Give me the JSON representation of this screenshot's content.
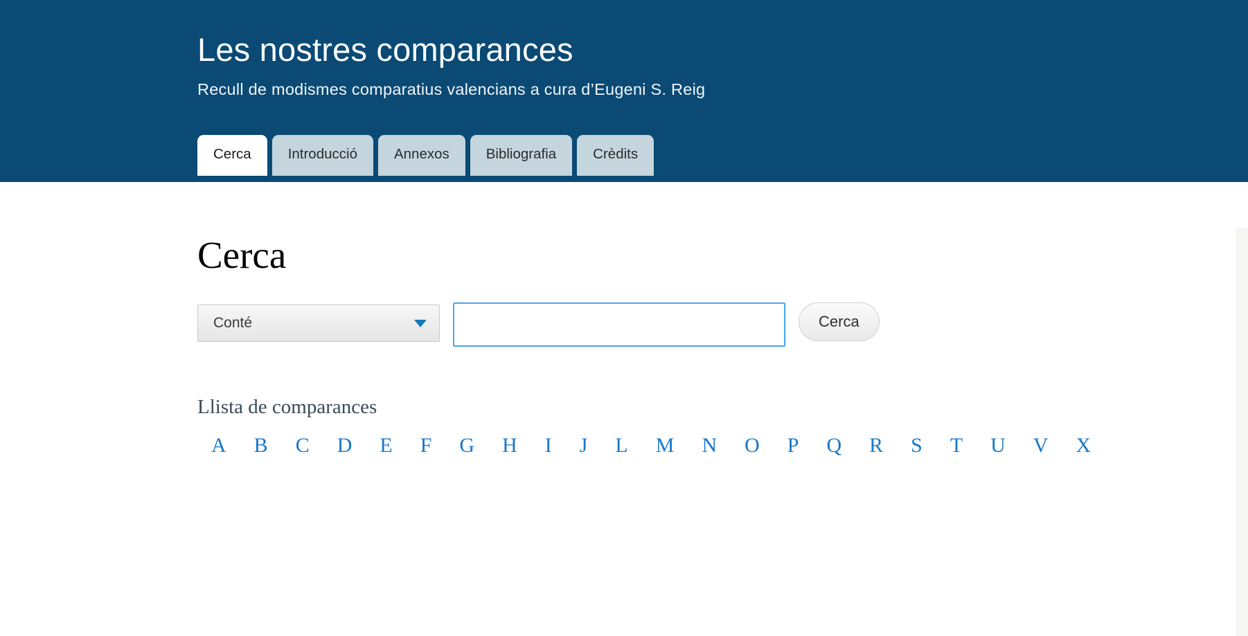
{
  "header": {
    "title": "Les nostres comparances",
    "subtitle": "Recull de modismes comparatius valencians a cura d’Eugeni S. Reig",
    "background_color": "#0a4a75"
  },
  "tabs": {
    "active_index": 0,
    "items": [
      {
        "label": "Cerca"
      },
      {
        "label": "Introducció"
      },
      {
        "label": "Annexos"
      },
      {
        "label": "Bibliografia"
      },
      {
        "label": "Crèdits"
      }
    ]
  },
  "main": {
    "section_title": "Cerca",
    "search": {
      "match_select": {
        "value": "Conté",
        "chevron": "chevron-down-icon"
      },
      "query_input": {
        "value": "",
        "placeholder": ""
      },
      "submit_label": "Cerca"
    },
    "list": {
      "title": "Llista de comparances",
      "letters": [
        "A",
        "B",
        "C",
        "D",
        "E",
        "F",
        "G",
        "H",
        "I",
        "J",
        "L",
        "M",
        "N",
        "O",
        "P",
        "Q",
        "R",
        "S",
        "T",
        "U",
        "V",
        "X"
      ],
      "link_color": "#1878c8"
    }
  }
}
